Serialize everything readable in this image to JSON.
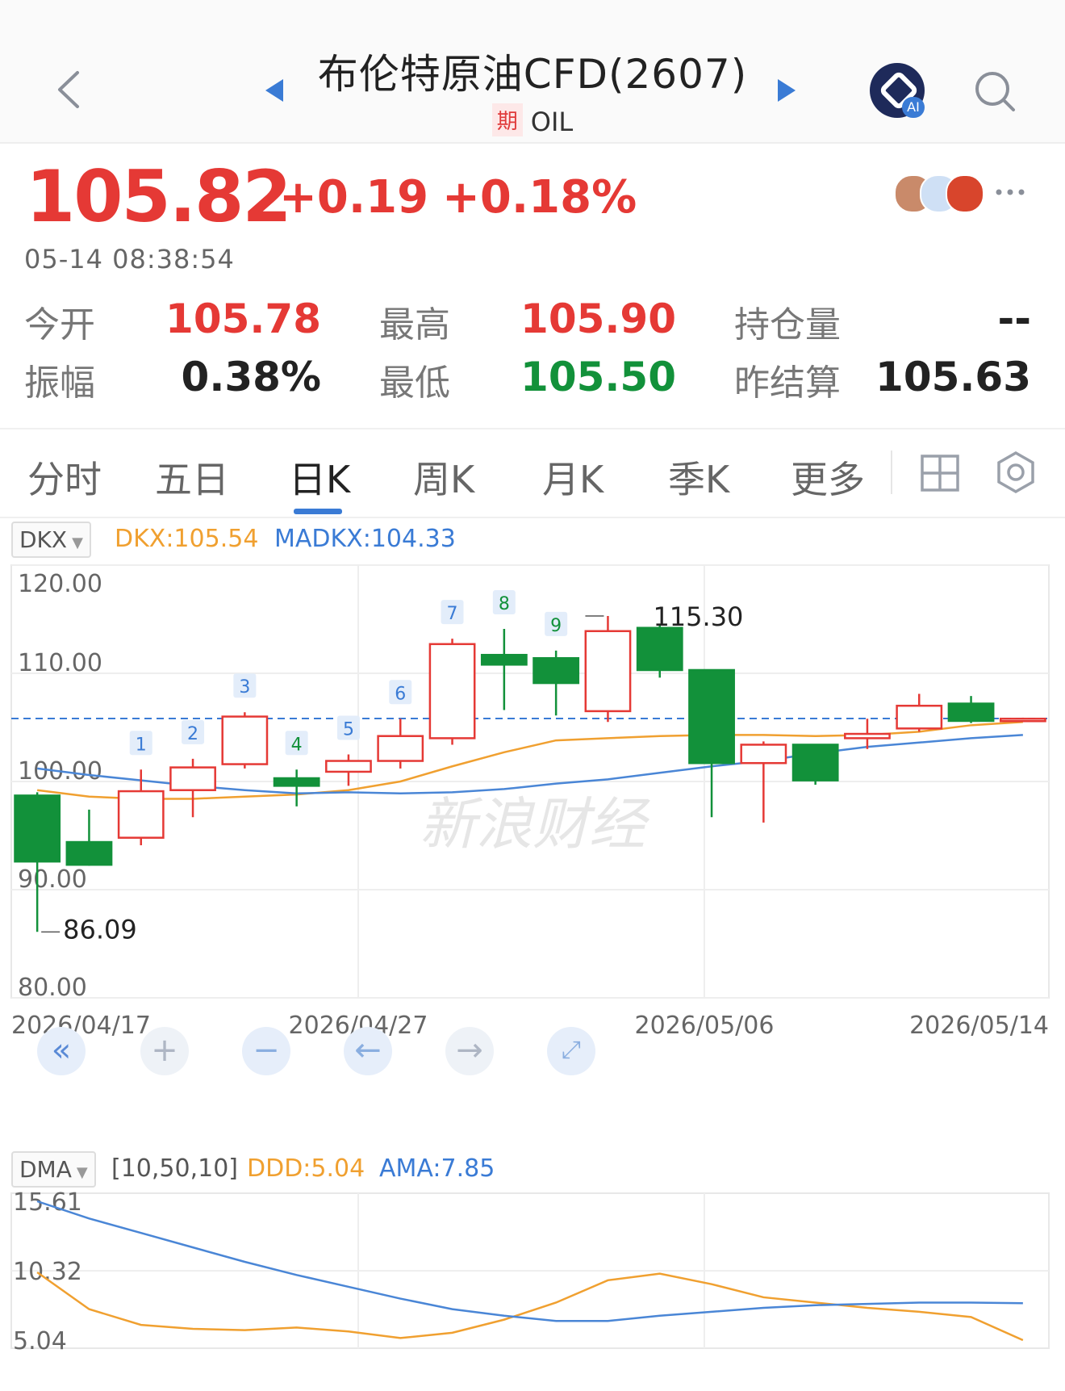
{
  "header": {
    "title": "布伦特原油CFD(2607)",
    "badge": "期",
    "code": "OIL",
    "ai_label": "AI"
  },
  "quote": {
    "price": "105.82",
    "change": "+0.19",
    "change_pct": "+0.18%",
    "time": "05-14 08:38:54"
  },
  "stats": {
    "open_label": "今开",
    "open": "105.78",
    "high_label": "最高",
    "high": "105.90",
    "oi_label": "持仓量",
    "oi": "--",
    "amp_label": "振幅",
    "amp": "0.38%",
    "low_label": "最低",
    "low": "105.50",
    "prev_label": "昨结算",
    "prev": "105.63"
  },
  "tabs": [
    "分时",
    "五日",
    "日K",
    "周K",
    "月K",
    "季K",
    "更多"
  ],
  "active_tab": "日K",
  "main_indicator": {
    "selector": "DKX",
    "dkx_label": "DKX:105.54",
    "madkx_label": "MADKX:104.33"
  },
  "sub_indicator": {
    "selector": "DMA",
    "params": "[10,50,10]",
    "ddd_label": "DDD:5.04",
    "ama_label": "AMA:7.85"
  },
  "colors": {
    "up": "#e53935",
    "down": "#12913a",
    "dkx": "#f0a030",
    "madkx": "#4a86d6",
    "accent": "#3a7bd5"
  },
  "icons": [
    "back-arrow-icon",
    "prev-triangle-icon",
    "next-triangle-icon",
    "ai-assistant-icon",
    "search-icon",
    "more-dots-icon",
    "grid-layout-icon",
    "settings-icon",
    "fast-back-icon",
    "zoom-in-icon",
    "zoom-out-icon",
    "pan-left-icon",
    "pan-right-icon",
    "fullscreen-icon"
  ],
  "watermark": "新浪财经",
  "chart_data": [
    {
      "type": "candlestick",
      "title": "",
      "y_ticks": [
        "120.00",
        "110.00",
        "100.00",
        "90.00",
        "80.00"
      ],
      "ylim": [
        80,
        120
      ],
      "x_ticks": [
        "2026/04/17",
        "2026/04/27",
        "2026/05/06",
        "2026/05/14"
      ],
      "annotations": {
        "max": "115.30",
        "min": "86.09"
      },
      "markers": [
        "1",
        "2",
        "3",
        "4",
        "5",
        "6",
        "7",
        "8",
        "9"
      ],
      "candles": [
        {
          "o": 98.7,
          "h": 99.0,
          "l": 86.1,
          "c": 92.6
        },
        {
          "o": 94.4,
          "h": 97.4,
          "l": 92.2,
          "c": 92.3
        },
        {
          "o": 94.8,
          "h": 101.1,
          "l": 94.1,
          "c": 99.1
        },
        {
          "o": 99.2,
          "h": 102.1,
          "l": 96.7,
          "c": 101.3
        },
        {
          "o": 101.6,
          "h": 106.4,
          "l": 101.2,
          "c": 106.0
        },
        {
          "o": 100.3,
          "h": 101.1,
          "l": 97.7,
          "c": 99.6
        },
        {
          "o": 100.9,
          "h": 102.5,
          "l": 99.6,
          "c": 101.9
        },
        {
          "o": 101.9,
          "h": 105.8,
          "l": 101.2,
          "c": 104.2
        },
        {
          "o": 104.0,
          "h": 113.2,
          "l": 103.4,
          "c": 112.7
        },
        {
          "o": 111.7,
          "h": 114.1,
          "l": 106.6,
          "c": 110.8
        },
        {
          "o": 111.4,
          "h": 112.1,
          "l": 106.1,
          "c": 109.1
        },
        {
          "o": 106.5,
          "h": 115.3,
          "l": 105.5,
          "c": 113.9
        },
        {
          "o": 114.2,
          "h": 114.4,
          "l": 109.6,
          "c": 110.3
        },
        {
          "o": 110.3,
          "h": 110.3,
          "l": 96.7,
          "c": 101.7
        },
        {
          "o": 101.7,
          "h": 103.7,
          "l": 96.2,
          "c": 103.4
        },
        {
          "o": 103.4,
          "h": 103.4,
          "l": 99.7,
          "c": 100.1
        },
        {
          "o": 104.0,
          "h": 105.8,
          "l": 103.0,
          "c": 104.4
        },
        {
          "o": 104.9,
          "h": 108.1,
          "l": 104.6,
          "c": 107.0
        },
        {
          "o": 107.2,
          "h": 107.9,
          "l": 105.4,
          "c": 105.6
        },
        {
          "o": 105.8,
          "h": 105.9,
          "l": 105.5,
          "c": 105.8
        }
      ],
      "series": [
        {
          "name": "DKX",
          "values": [
            99.2,
            98.6,
            98.4,
            98.4,
            98.6,
            98.8,
            99.2,
            100.0,
            101.4,
            102.7,
            103.8,
            104.0,
            104.2,
            104.3,
            104.3,
            104.2,
            104.3,
            104.6,
            105.2,
            105.5
          ]
        },
        {
          "name": "MADKX",
          "values": [
            101.2,
            100.6,
            100.1,
            99.6,
            99.2,
            98.9,
            99.0,
            98.9,
            99.0,
            99.3,
            99.8,
            100.2,
            100.8,
            101.4,
            101.9,
            102.6,
            103.2,
            103.6,
            104.0,
            104.3
          ]
        }
      ],
      "reference_line": 105.82
    },
    {
      "type": "line",
      "title": "",
      "y_ticks": [
        "15.61",
        "10.32",
        "5.04"
      ],
      "ylim": [
        5.04,
        15.61
      ],
      "series": [
        {
          "name": "DDD",
          "values": [
            10.2,
            7.4,
            6.2,
            5.9,
            5.8,
            6.0,
            5.7,
            5.2,
            5.6,
            6.6,
            7.9,
            9.6,
            10.1,
            9.3,
            8.3,
            7.9,
            7.5,
            7.2,
            6.8,
            5.04
          ]
        },
        {
          "name": "AMA",
          "values": [
            15.61,
            14.3,
            13.2,
            12.1,
            11.0,
            10.0,
            9.1,
            8.2,
            7.4,
            6.9,
            6.5,
            6.5,
            6.9,
            7.2,
            7.5,
            7.7,
            7.8,
            7.9,
            7.9,
            7.85
          ]
        }
      ]
    }
  ]
}
